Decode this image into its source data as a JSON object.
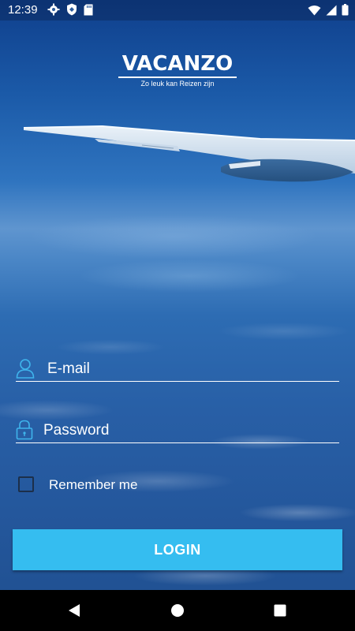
{
  "status_bar": {
    "time": "12:39",
    "icons_left": [
      "gear-icon",
      "shield-icon",
      "sd-card-icon"
    ],
    "icons_right": [
      "wifi-icon",
      "signal-icon",
      "battery-icon"
    ]
  },
  "logo": {
    "wordmark": "VACANZO",
    "tagline": "Zo leuk kan Reizen zijn"
  },
  "form": {
    "email_label": "E-mail",
    "email_icon": "user-icon",
    "password_label": "Password",
    "password_icon": "lock-icon",
    "remember_label": "Remember me",
    "remember_checked": false,
    "login_label": "LOGIN"
  },
  "colors": {
    "accent": "#35bdf0",
    "text": "#ffffff",
    "nav_background": "#000000"
  },
  "nav_bar": {
    "buttons": [
      "back-icon",
      "home-icon",
      "recents-icon"
    ]
  }
}
